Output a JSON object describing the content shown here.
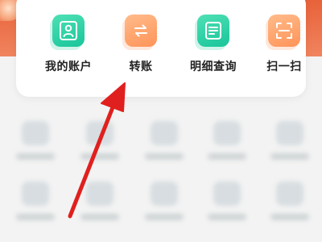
{
  "quick_actions": [
    {
      "label": "我的账户",
      "icon": "user-card-icon",
      "color": "#22c99f"
    },
    {
      "label": "转账",
      "icon": "transfer-arrows-icon",
      "color": "#ff9c63"
    },
    {
      "label": "明细查询",
      "icon": "document-lines-icon",
      "color": "#22c99f"
    },
    {
      "label": "扫一扫",
      "icon": "scan-frame-icon",
      "color": "#ff9c63"
    }
  ],
  "colors": {
    "header": "#e8623a",
    "arrow": "#e0201e",
    "card": "#ffffff"
  }
}
